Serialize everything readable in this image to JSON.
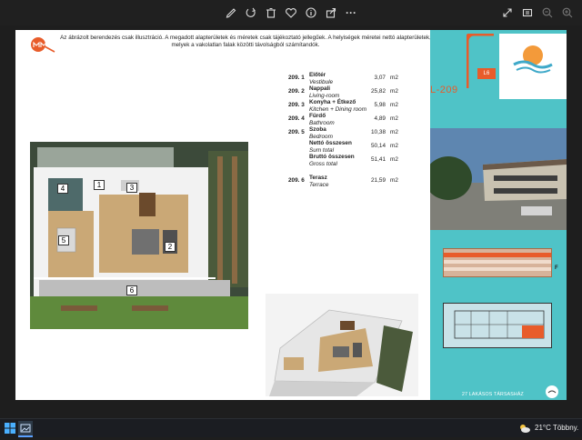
{
  "toolbar": {
    "icons": [
      "edit-icon",
      "rotate-icon",
      "delete-icon",
      "favorite-icon",
      "info-icon",
      "share-icon",
      "more-icon",
      "fullscreen-icon",
      "fit-icon",
      "zoom-out-icon",
      "zoom-in-icon"
    ],
    "more_label": "···"
  },
  "document": {
    "disclaimer_line1": "Az ábrázolt berendezés csak illusztráció. A megadott alapterületek és méretek csak tájékoztató jellegűek. A helyiségek méretei nettó alapterületek,",
    "disclaimer_line2": "melyek a vakolatlan falak közötti távolságból számítandók.",
    "unit": "m2",
    "rooms": [
      {
        "num": "209. 1",
        "name": "Előtér",
        "sub": "Vestibule",
        "value": "3,07"
      },
      {
        "num": "209. 2",
        "name": "Nappali",
        "sub": "Living-room",
        "value": "25,82"
      },
      {
        "num": "209. 3",
        "name": "Konyha + Étkező",
        "sub": "Kitchen + Dining room",
        "value": "5,98"
      },
      {
        "num": "209. 4",
        "name": "Fürdő",
        "sub": "Bathroom",
        "value": "4,89"
      },
      {
        "num": "209. 5",
        "name": "Szoba",
        "sub": "Bedroom",
        "value": "10,38"
      }
    ],
    "net_total": {
      "name": "Nettó összesen",
      "sub": "Sum total",
      "value": "50,14"
    },
    "gross_total": {
      "name": "Bruttó összesen",
      "sub": "Gross total",
      "value": "51,41"
    },
    "terrace": {
      "num": "209. 6",
      "name": "Terasz",
      "sub": "Terrace",
      "value": "21,59"
    },
    "plan_labels": [
      "1",
      "2",
      "3",
      "4",
      "5",
      "6"
    ]
  },
  "side_panel": {
    "unit_label": "L-209",
    "floor_badge": "L6",
    "elevation_marker": "F",
    "footer": "27 LAKÁSOS TÁRSASHÁZ"
  },
  "taskbar": {
    "weather": "21°C  Többny."
  },
  "colors": {
    "accent": "#e85c2a",
    "panel": "#4fc3c7",
    "wood": "#caa876"
  }
}
